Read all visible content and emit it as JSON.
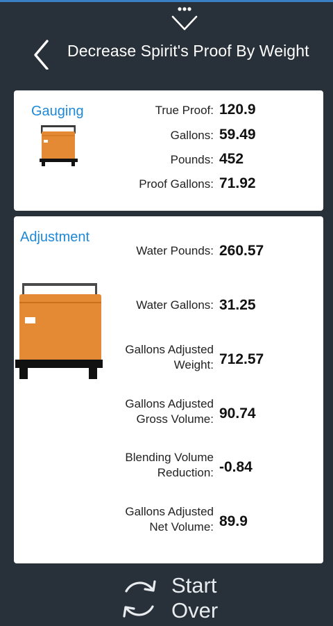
{
  "header": {
    "title": "Decrease Spirit's Proof By Weight",
    "icons": {
      "overflow": "more-dots-chevron-icon",
      "back": "chevron-left-icon"
    }
  },
  "gauging": {
    "title": "Gauging",
    "icon": "tote-container-icon",
    "rows": [
      {
        "label": "True Proof:",
        "value": "120.9"
      },
      {
        "label": "Gallons:",
        "value": "59.49"
      },
      {
        "label": "Pounds:",
        "value": "452"
      },
      {
        "label": "Proof Gallons:",
        "value": "71.92"
      }
    ]
  },
  "adjustment": {
    "title": "Adjustment",
    "icon": "tote-container-icon",
    "rows": [
      {
        "label": [
          "Water Pounds:"
        ],
        "value": "260.57"
      },
      {
        "label": [
          "Water Gallons:"
        ],
        "value": "31.25"
      },
      {
        "label": [
          "Gallons Adjusted",
          "Weight:"
        ],
        "value": "712.57"
      },
      {
        "label": [
          "Gallons Adjusted",
          "Gross Volume:"
        ],
        "value": "90.74"
      },
      {
        "label": [
          "Blending Volume",
          "Reduction:"
        ],
        "value": "-0.84"
      },
      {
        "label": [
          "Gallons Adjusted",
          "Net Volume:"
        ],
        "value": "89.9"
      }
    ]
  },
  "footer": {
    "start_over_line1": "Start",
    "start_over_line2": "Over",
    "icon": "refresh-icon"
  },
  "colors": {
    "background": "#283039",
    "accent_blue": "#1e88d6",
    "tote_orange": "#e58a34",
    "card": "#ffffff"
  }
}
